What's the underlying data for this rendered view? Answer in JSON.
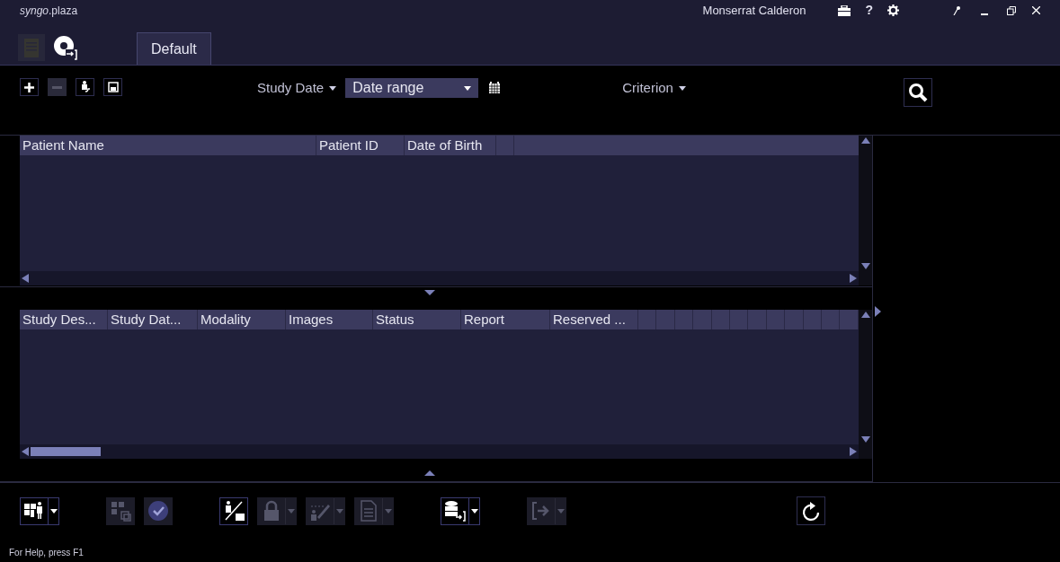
{
  "window": {
    "title": "*syngo*.plaza",
    "user": "Monserrat Calderon",
    "help": "?"
  },
  "tabs": [
    {
      "label": "Default",
      "selected": true
    }
  ],
  "search": {
    "study_date": "Study Date",
    "date_range": "Date range",
    "criterion": "Criterion"
  },
  "patient_table": {
    "columns": [
      "Patient Name",
      "Patient ID",
      "Date of Birth"
    ]
  },
  "study_table": {
    "columns": [
      "Study Des...",
      "Study Dat...",
      "Modality",
      "Images",
      "Status",
      "Report",
      "Reserved ..."
    ]
  },
  "toolbar_groups": [
    [
      {
        "kind": "layout",
        "disabled": false,
        "menu": true
      }
    ],
    [
      {
        "kind": "series",
        "disabled": true,
        "menu": false
      },
      {
        "kind": "check",
        "disabled": true,
        "menu": false
      }
    ],
    [
      {
        "kind": "patient-report",
        "disabled": false,
        "menu": false
      },
      {
        "kind": "lock",
        "disabled": true,
        "menu": true
      },
      {
        "kind": "edit",
        "disabled": true,
        "menu": true
      },
      {
        "kind": "document",
        "disabled": true,
        "menu": true
      }
    ],
    [
      {
        "kind": "transfer",
        "disabled": false,
        "menu": true
      }
    ],
    [
      {
        "kind": "export",
        "disabled": true,
        "menu": true
      }
    ]
  ],
  "status_bar": "For Help, press F1"
}
